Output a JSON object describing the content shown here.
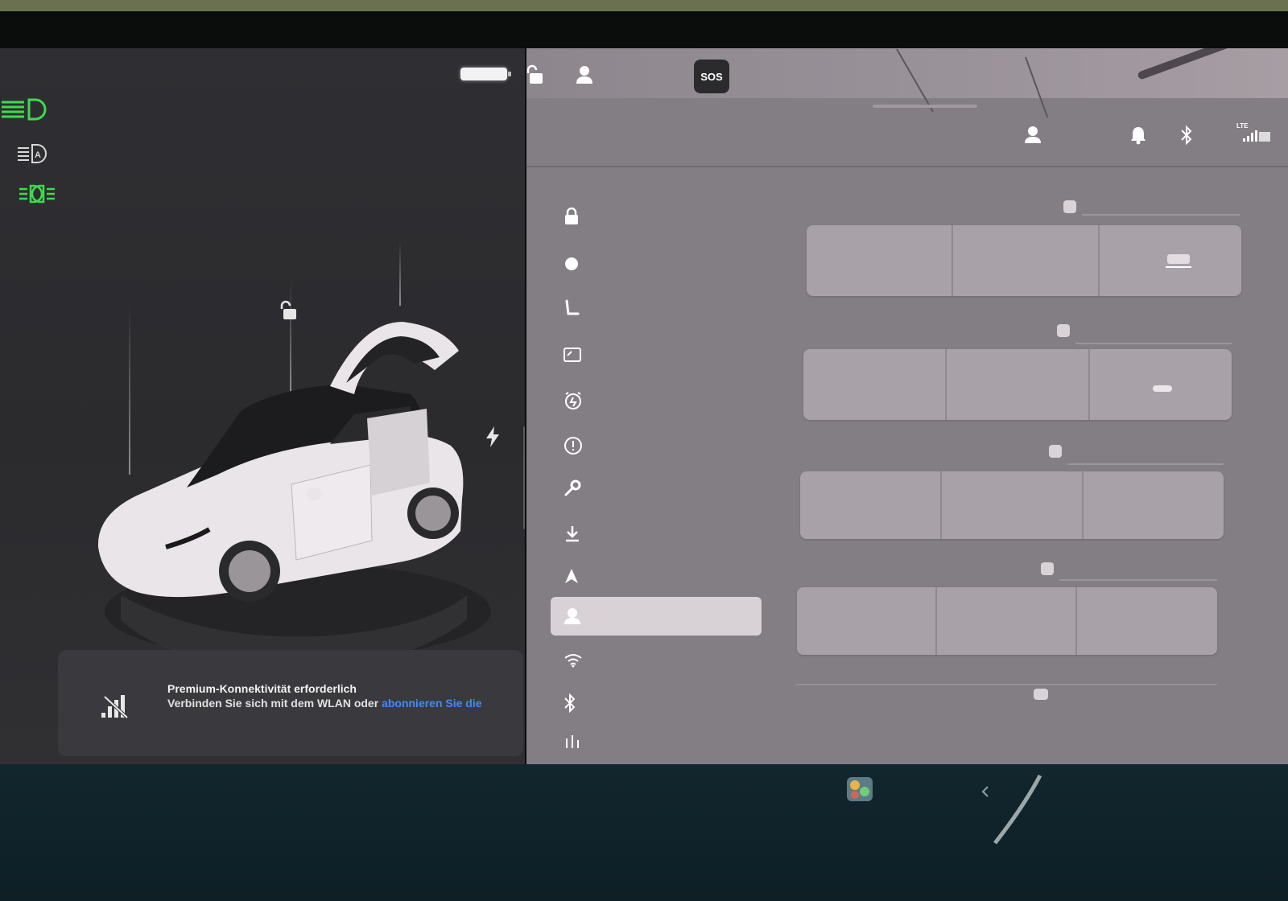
{
  "colors": {
    "light_indicator_active": "#3ddc4a",
    "link_blue": "#3d8cff",
    "left_background": "#2e2e31",
    "right_background": "#837d84",
    "bottom_bar": "#10232b"
  },
  "top_bar": {
    "sos_label": "SOS",
    "icons": [
      "unlock-icon",
      "profile-icon"
    ]
  },
  "status_bar": {
    "network_label": "LTE",
    "icons": [
      "profile-icon",
      "bell-icon",
      "bluetooth-icon",
      "signal-icon"
    ]
  },
  "left_panel": {
    "light_icons": [
      "headlight-icon",
      "auto-highbeam-icon",
      "parking-light-icon"
    ],
    "notice": {
      "title": "Premium-Konnektivität erforderlich",
      "body": "Verbinden Sie sich mit dem WLAN oder",
      "link": "abonnieren Sie die"
    }
  },
  "sidebar": {
    "items": [
      {
        "icon": "lock-icon"
      },
      {
        "icon": "lightbulb-icon"
      },
      {
        "icon": "seat-icon"
      },
      {
        "icon": "display-icon"
      },
      {
        "icon": "alarm-icon"
      },
      {
        "icon": "alert-icon"
      },
      {
        "icon": "wrench-icon"
      },
      {
        "icon": "download-icon"
      },
      {
        "icon": "navigation-icon"
      },
      {
        "icon": "profile-icon",
        "selected": true
      },
      {
        "icon": "wifi-icon"
      },
      {
        "icon": "bluetooth-icon"
      },
      {
        "icon": "equalizer-icon"
      }
    ]
  },
  "dock": {
    "icons": [
      "app-launcher-icon",
      "chevron-left-icon"
    ]
  }
}
